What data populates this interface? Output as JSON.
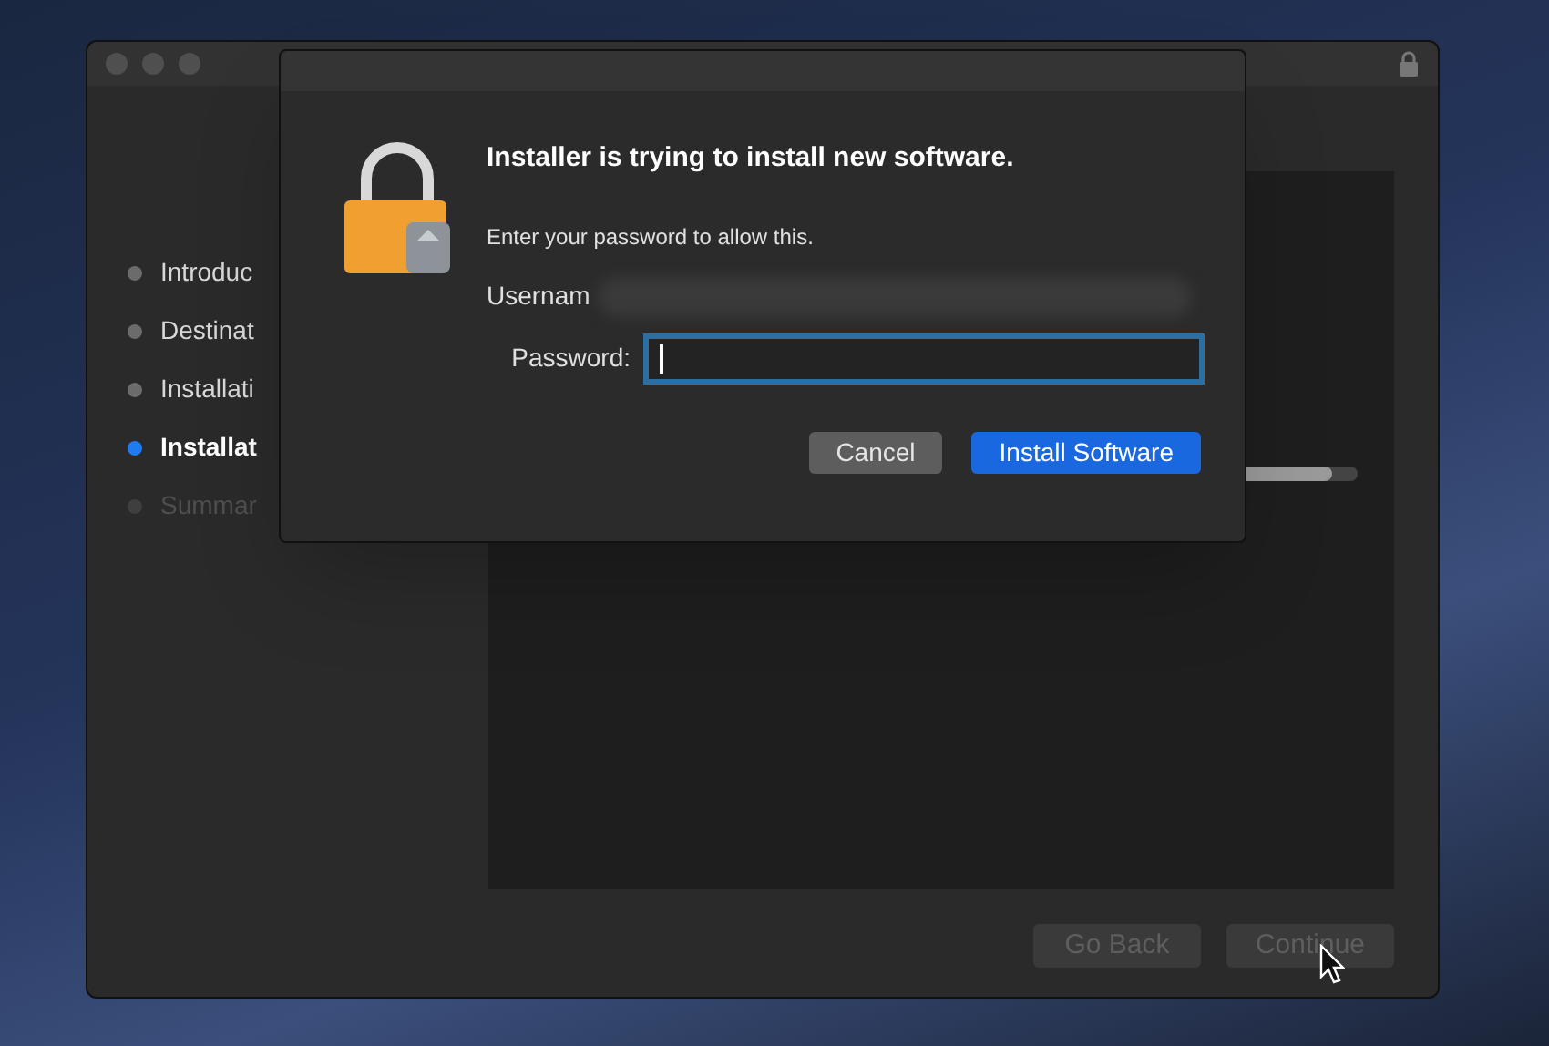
{
  "installer": {
    "steps": [
      {
        "label": "Introduc",
        "selected": false,
        "disabled": false
      },
      {
        "label": "Destinat",
        "selected": false,
        "disabled": false
      },
      {
        "label": "Installati",
        "selected": false,
        "disabled": false
      },
      {
        "label": "Installat",
        "selected": true,
        "disabled": false
      },
      {
        "label": "Summar",
        "selected": false,
        "disabled": true
      }
    ],
    "progress": {
      "level": 0.97
    },
    "buttons": [
      {
        "label": "Go Back",
        "disabled": true
      },
      {
        "label": "Continue",
        "disabled": true
      }
    ]
  },
  "dialog": {
    "title": "Installer is trying to install new software.",
    "message": "Enter your password to allow this.",
    "username_label": "Usernam",
    "password_label": "Password:",
    "password": {
      "focused": true
    },
    "buttons": [
      {
        "label": "Cancel",
        "kind": "secondary"
      },
      {
        "label": "Install Software",
        "kind": "primary"
      }
    ]
  }
}
